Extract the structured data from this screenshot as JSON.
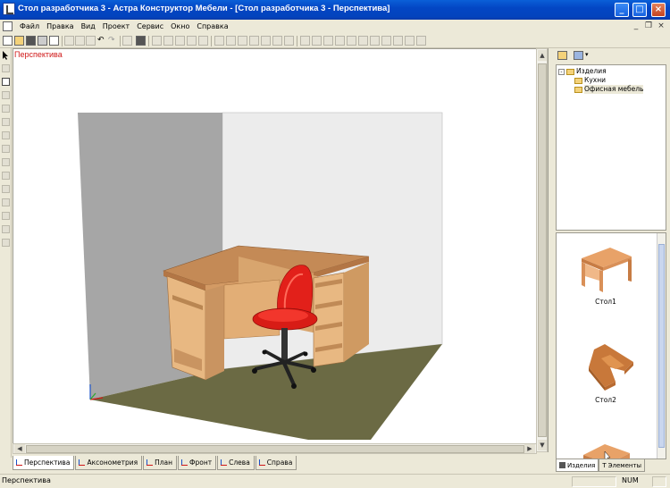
{
  "window": {
    "title": "Стол разработчика 3 - Астра Конструктор Мебели - [Стол разработчика 3 - Перспектива]",
    "buttons": {
      "minimize": "_",
      "maximize": "□",
      "close": "×"
    }
  },
  "menu": {
    "items": [
      "Файл",
      "Правка",
      "Вид",
      "Проект",
      "Сервис",
      "Окно",
      "Справка"
    ],
    "mdi_buttons": {
      "minimize": "_",
      "restore": "❐",
      "close": "×"
    }
  },
  "viewport": {
    "label": "Перспектива",
    "colors": {
      "left_wall": "#a6a6a6",
      "back_wall": "#ececec",
      "floor": "#6b6a44",
      "desk": "#e3b47c",
      "chair_seat": "#e2201a",
      "chair_base": "#2a2a2a"
    }
  },
  "view_tabs": [
    "Перспектива",
    "Аксонометрия",
    "План",
    "Фронт",
    "Слева",
    "Справа"
  ],
  "right_panel": {
    "tree": {
      "root": "Изделия",
      "children": [
        "Кухни",
        "Офисная мебель"
      ]
    },
    "gallery": [
      {
        "caption": "Стол1"
      },
      {
        "caption": "Стол2"
      },
      {
        "caption": ""
      }
    ],
    "tabs": [
      "Изделия",
      "Элементы"
    ]
  },
  "status": {
    "text": "Перспектива",
    "num": "NUM"
  }
}
